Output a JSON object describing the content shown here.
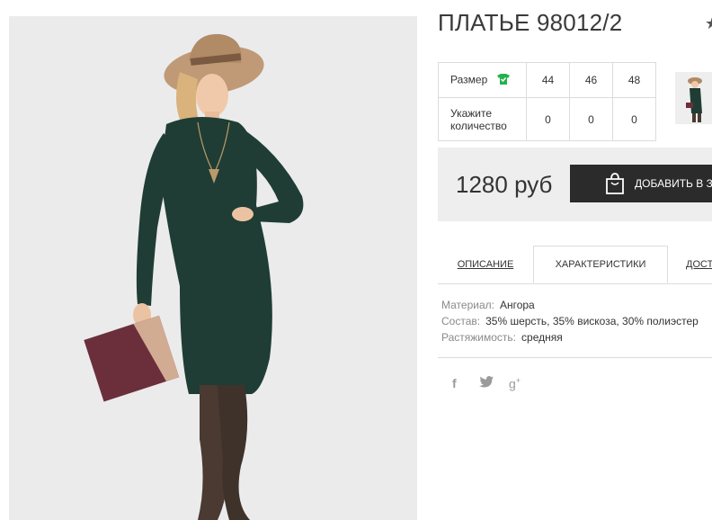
{
  "product": {
    "title": "ПЛАТЬЕ 98012/2",
    "favorite_icon": "star-icon",
    "image_alt": "model in green knit dress with hat and clutch"
  },
  "sizes": {
    "row_size_label": "Размер",
    "row_qty_label_line1": "Укажите",
    "row_qty_label_line2": "количество",
    "size_guide_icon": "tshirt-check-icon",
    "sizes": [
      "44",
      "46",
      "48"
    ],
    "quantities": [
      "0",
      "0",
      "0"
    ]
  },
  "buy": {
    "price": "1280 руб",
    "add_label": "ДОБАВИТЬ В ЗА",
    "bag_icon": "shopping-bag-icon"
  },
  "tabs": [
    {
      "label": "ОПИСАНИЕ"
    },
    {
      "label": "ХАРАКТЕРИСТИКИ",
      "active": true
    },
    {
      "label": "ДОСТ"
    }
  ],
  "specs": [
    {
      "key": "Материал:",
      "value": "Ангора"
    },
    {
      "key": "Состав:",
      "value": "35% шерсть, 35% вискоза, 30% полиэстер"
    },
    {
      "key": "Растяжимость:",
      "value": "средняя"
    }
  ],
  "social": [
    {
      "icon": "facebook-icon",
      "glyph": "f"
    },
    {
      "icon": "twitter-icon",
      "glyph": "🐦"
    },
    {
      "icon": "google-plus-icon",
      "glyph": "g⁺"
    }
  ],
  "colors": {
    "dress": "#1f3d34",
    "button": "#2b2b2b",
    "check_green": "#22b24c",
    "panel": "#eeeeee"
  }
}
